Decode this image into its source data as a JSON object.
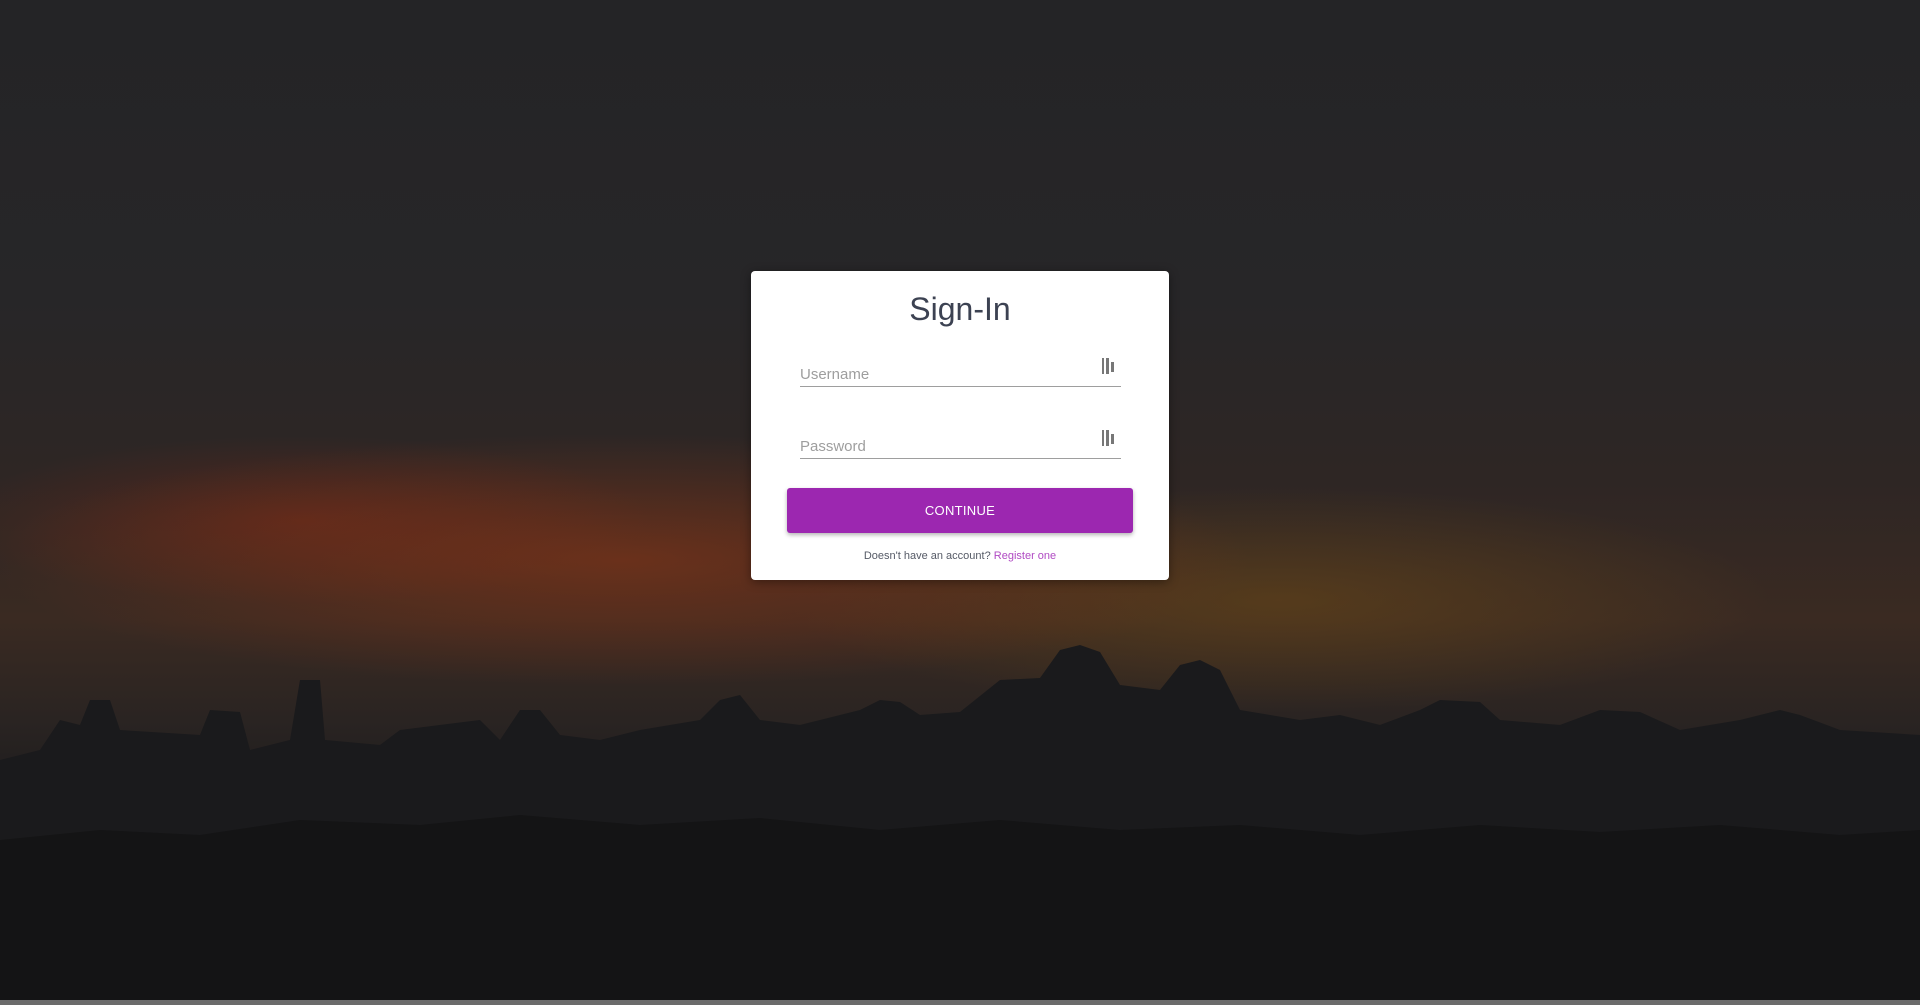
{
  "page": {
    "title": "Sign-In"
  },
  "form": {
    "username": {
      "value": "",
      "placeholder": "Username",
      "icon": "password-manager-key-icon"
    },
    "password": {
      "value": "",
      "placeholder": "Password",
      "icon": "password-manager-key-icon"
    },
    "continue_label": "CONTINUE"
  },
  "footer": {
    "prompt": "Doesn't have an account?",
    "register_label": "Register one"
  },
  "colors": {
    "accent": "#9c27b0",
    "link": "#b04ac3",
    "title": "#3c4252",
    "card": "#ffffff"
  }
}
